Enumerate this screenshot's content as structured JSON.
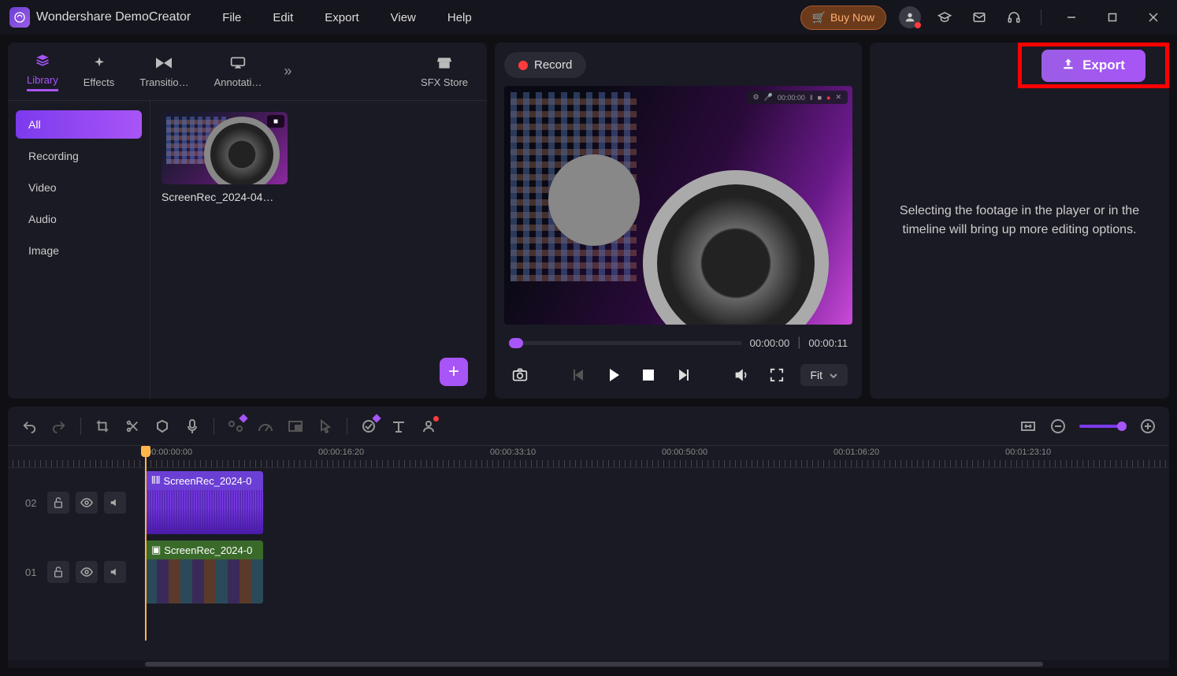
{
  "app": {
    "title": "Wondershare DemoCreator"
  },
  "menu": {
    "file": "File",
    "edit": "Edit",
    "export": "Export",
    "view": "View",
    "help": "Help"
  },
  "titlebar": {
    "buy_now": "Buy Now"
  },
  "library": {
    "tabs": {
      "library": "Library",
      "effects": "Effects",
      "transitions": "Transitio…",
      "annotations": "Annotati…",
      "sfx": "SFX Store"
    },
    "categories": {
      "all": "All",
      "recording": "Recording",
      "video": "Video",
      "audio": "Audio",
      "image": "Image"
    },
    "clip": {
      "name": "ScreenRec_2024-04…"
    }
  },
  "preview": {
    "record": "Record",
    "hud_time": "00:00:00",
    "current": "00:00:00",
    "duration": "00:00:11",
    "fit": "Fit"
  },
  "props": {
    "export": "Export",
    "hint": "Selecting the footage in the player or in the timeline will bring up more editing options."
  },
  "timeline": {
    "ruler": [
      "00:00:00:00",
      "00:00:16:20",
      "00:00:33:10",
      "00:00:50:00",
      "00:01:06:20",
      "00:01:23:10"
    ],
    "tracks": {
      "t2_num": "02",
      "t2_clip": "ScreenRec_2024-0",
      "t1_num": "01",
      "t1_clip": "ScreenRec_2024-0"
    }
  }
}
